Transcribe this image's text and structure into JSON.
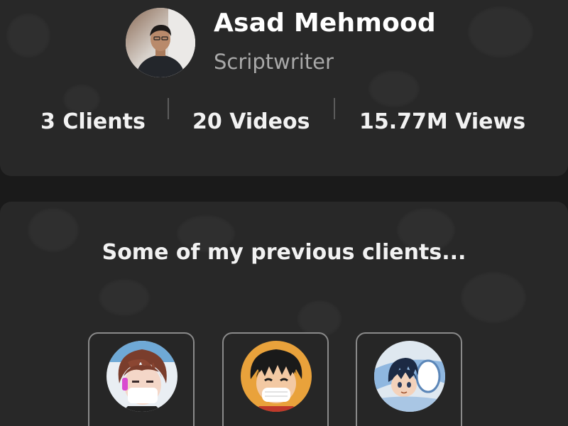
{
  "profile": {
    "name": "Asad Mehmood",
    "role": "Scriptwriter",
    "avatar_icon": "person-photo-icon"
  },
  "stats": [
    {
      "label": "3 Clients"
    },
    {
      "label": "20 Videos"
    },
    {
      "label": "15.77M Views"
    }
  ],
  "clients_section": {
    "title": "Some of my previous clients...",
    "clients": [
      {
        "avatar_icon": "anime-boy-avatar-icon",
        "accent": "#e24a4a"
      },
      {
        "avatar_icon": "luffy-avatar-icon",
        "accent": "#e24a4a"
      },
      {
        "avatar_icon": "anime-blue-avatar-icon",
        "accent": "#e24a4a"
      }
    ]
  },
  "colors": {
    "background": "#1a1a1a",
    "card": "#282828",
    "accent": "#e24a4a",
    "muted_text": "#a9a9a9"
  }
}
